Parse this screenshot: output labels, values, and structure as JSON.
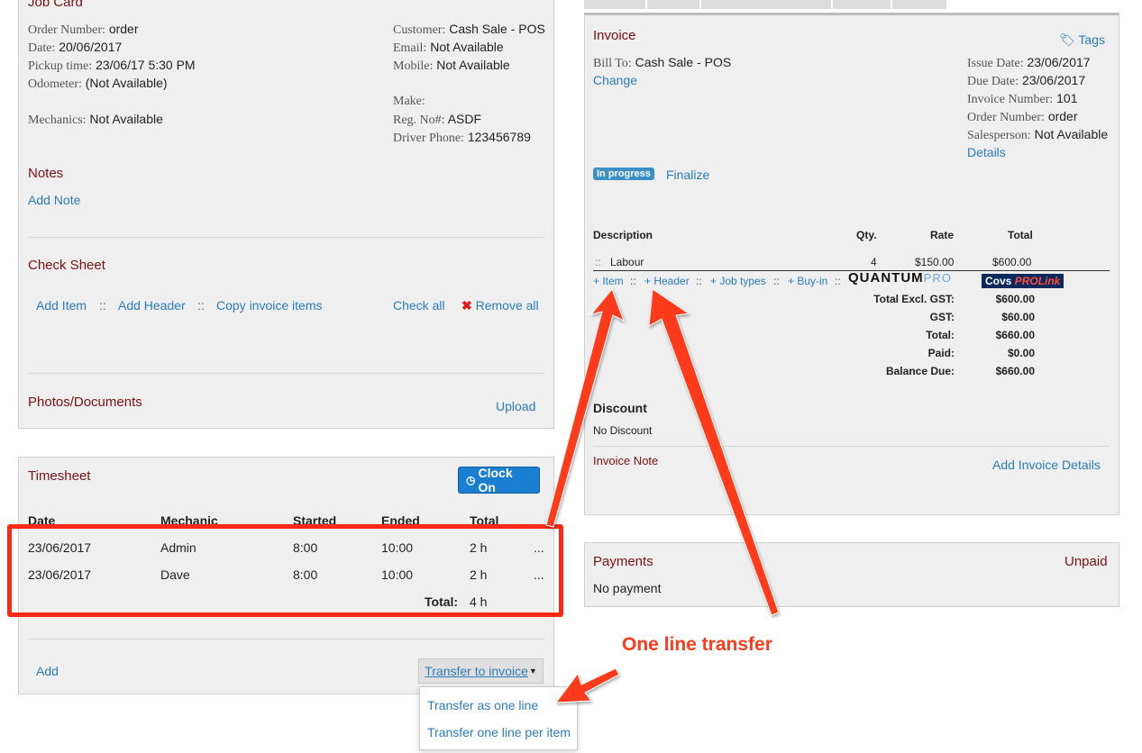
{
  "colors": {
    "link": "#2b7bba",
    "heading": "#7a1010",
    "accent_red": "#ff3b1a",
    "button_blue": "#1a7fd0",
    "badge_blue": "#3a8fc7"
  },
  "job_card": {
    "title": "Job Card",
    "order_number_label": "Order Number:",
    "order_number": "order",
    "date_label": "Date:",
    "date": "20/06/2017",
    "pickup_label": "Pickup time:",
    "pickup": "23/06/17 5:30 PM",
    "odometer_label": "Odometer:",
    "odometer": "(Not Available)",
    "mechanics_label": "Mechanics:",
    "mechanics": "Not Available",
    "customer_label": "Customer:",
    "customer": "Cash Sale - POS",
    "email_label": "Email:",
    "email": "Not Available",
    "mobile_label": "Mobile:",
    "mobile": "Not Available",
    "make_label": "Make:",
    "reg_label": "Reg. No#:",
    "reg": "ASDF",
    "driver_phone_label": "Driver Phone:",
    "driver_phone": "123456789"
  },
  "notes": {
    "title": "Notes",
    "add_note": "Add Note"
  },
  "check_sheet": {
    "title": "Check Sheet",
    "add_item": "Add Item",
    "sep": "::",
    "add_header": "Add Header",
    "copy_invoice_items": "Copy invoice items",
    "check_all": "Check all",
    "remove_all": "Remove all",
    "remove_icon": "x-icon"
  },
  "photos": {
    "title": "Photos/Documents",
    "upload": "Upload"
  },
  "timesheet": {
    "title": "Timesheet",
    "clock_on": "Clock On",
    "clock_icon": "clock-icon",
    "columns": [
      "Date",
      "Mechanic",
      "Started",
      "Ended",
      "Total"
    ],
    "rows": [
      {
        "date": "23/06/2017",
        "mechanic": "Admin",
        "started": "8:00",
        "ended": "10:00",
        "total": "2 h",
        "more": "..."
      },
      {
        "date": "23/06/2017",
        "mechanic": "Dave",
        "started": "8:00",
        "ended": "10:00",
        "total": "2 h",
        "more": "..."
      }
    ],
    "total_label": "Total:",
    "total_value": "4 h",
    "add": "Add",
    "transfer": "Transfer to invoice",
    "transfer_options": [
      "Transfer as one line",
      "Transfer one line per item"
    ]
  },
  "invoice": {
    "title": "Invoice",
    "tags": "Tags",
    "bill_to_label": "Bill To:",
    "bill_to": "Cash Sale - POS",
    "change": "Change",
    "issue_date_label": "Issue Date:",
    "issue_date": "23/06/2017",
    "due_date_label": "Due Date:",
    "due_date": "23/06/2017",
    "invoice_number_label": "Invoice Number:",
    "invoice_number": "101",
    "order_number_label": "Order Number:",
    "order_number": "order",
    "salesperson_label": "Salesperson:",
    "salesperson": "Not Available",
    "details": "Details",
    "status_badge": "In progress",
    "finalize": "Finalize",
    "columns": {
      "description": "Description",
      "qty": "Qty.",
      "rate": "Rate",
      "total": "Total"
    },
    "line": {
      "handle": "::",
      "description": "Labour",
      "qty": "4",
      "rate": "$150.00",
      "total": "$600.00"
    },
    "add_links": {
      "item": "+ Item",
      "header": "+ Header",
      "job_types": "+ Job types",
      "buy_in": "+ Buy-in",
      "sep": "::"
    },
    "logo_quantum": "QUANTUM",
    "logo_quantum_pro": "PRO",
    "logo_covs": "Covs",
    "logo_prolink": "PROLink",
    "totals": [
      {
        "label": "Total Excl. GST:",
        "value": "$600.00"
      },
      {
        "label": "GST:",
        "value": "$60.00"
      },
      {
        "label": "Total:",
        "value": "$660.00"
      },
      {
        "label": "Paid:",
        "value": "$0.00"
      },
      {
        "label": "Balance Due:",
        "value": "$660.00"
      }
    ],
    "discount_title": "Discount",
    "discount": "No Discount",
    "invoice_note": "Invoice Note",
    "add_invoice_details": "Add Invoice Details"
  },
  "payments": {
    "title": "Payments",
    "status": "Unpaid",
    "none": "No payment"
  },
  "annotation": {
    "callout": "One line transfer"
  }
}
